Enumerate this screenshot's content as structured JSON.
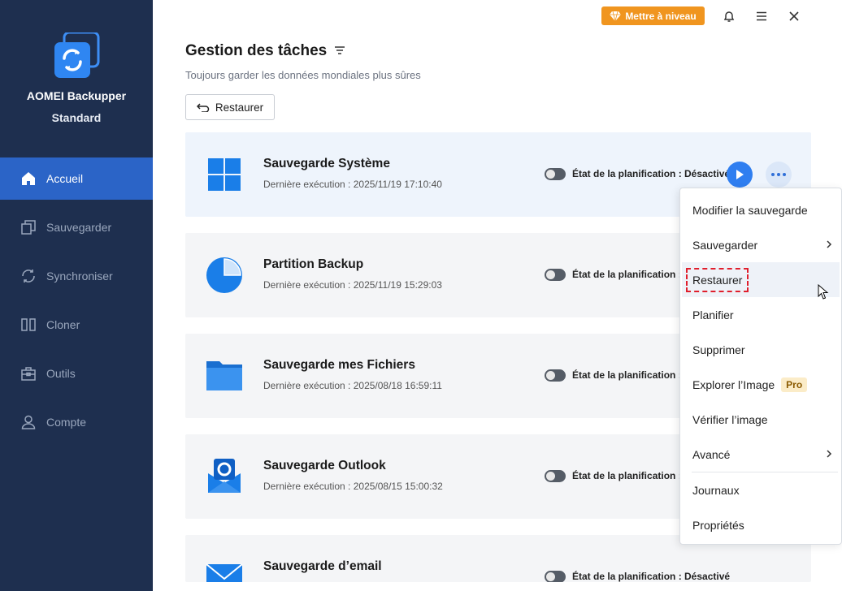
{
  "app": {
    "name": "AOMEI Backupper",
    "edition": "Standard"
  },
  "sidebar": {
    "items": [
      {
        "label": "Accueil",
        "icon": "home-icon",
        "active": true
      },
      {
        "label": "Sauvegarder",
        "icon": "backup-icon",
        "active": false
      },
      {
        "label": "Synchroniser",
        "icon": "sync-icon",
        "active": false
      },
      {
        "label": "Cloner",
        "icon": "clone-icon",
        "active": false
      },
      {
        "label": "Outils",
        "icon": "toolbox-icon",
        "active": false
      },
      {
        "label": "Compte",
        "icon": "user-icon",
        "active": false
      }
    ]
  },
  "topbar": {
    "upgrade_label": "Mettre à niveau",
    "icons": [
      "bell-icon",
      "menu-icon",
      "close-icon"
    ]
  },
  "header": {
    "title": "Gestion des tâches",
    "subtitle": "Toujours garder les données mondiales plus sûres",
    "restore_label": "Restaurer"
  },
  "tasks": [
    {
      "name": "Sauvegarde Système",
      "last_run": "Dernière exécution : 2025/11/19 17:10:40",
      "schedule": "État de la planification : Désactivé",
      "icon": "windows-icon"
    },
    {
      "name": "Partition Backup",
      "last_run": "Dernière exécution : 2025/11/19 15:29:03",
      "schedule": "État de la planification : D",
      "icon": "pie-icon"
    },
    {
      "name": "Sauvegarde mes Fichiers",
      "last_run": "Dernière exécution : 2025/08/18 16:59:11",
      "schedule": "État de la planification : D",
      "icon": "folder-icon"
    },
    {
      "name": "Sauvegarde Outlook",
      "last_run": "Dernière exécution : 2025/08/15 15:00:32",
      "schedule": "État de la planification : D",
      "icon": "outlook-icon"
    },
    {
      "name": "Sauvegarde d’email",
      "last_run": "",
      "schedule": "État de la planification : Désactivé",
      "icon": "mail-icon"
    }
  ],
  "context_menu": {
    "items": [
      {
        "label": "Modifier la sauvegarde"
      },
      {
        "label": "Sauvegarder",
        "submenu": true
      },
      {
        "label": "Restaurer",
        "highlighted": true
      },
      {
        "label": "Planifier"
      },
      {
        "label": "Supprimer"
      },
      {
        "label": "Explorer l’Image",
        "badge": "Pro"
      },
      {
        "label": "Vérifier l’image"
      },
      {
        "label": "Avancé",
        "submenu": true
      },
      {
        "label": "Journaux"
      },
      {
        "label": "Propriétés"
      }
    ]
  },
  "colors": {
    "sidebar_bg": "#1e2f4f",
    "active_nav": "#2b64c7",
    "accent_blue": "#2f7ef0",
    "upgrade_orange": "#f0951f",
    "highlight_dashed": "#e01e2c"
  }
}
